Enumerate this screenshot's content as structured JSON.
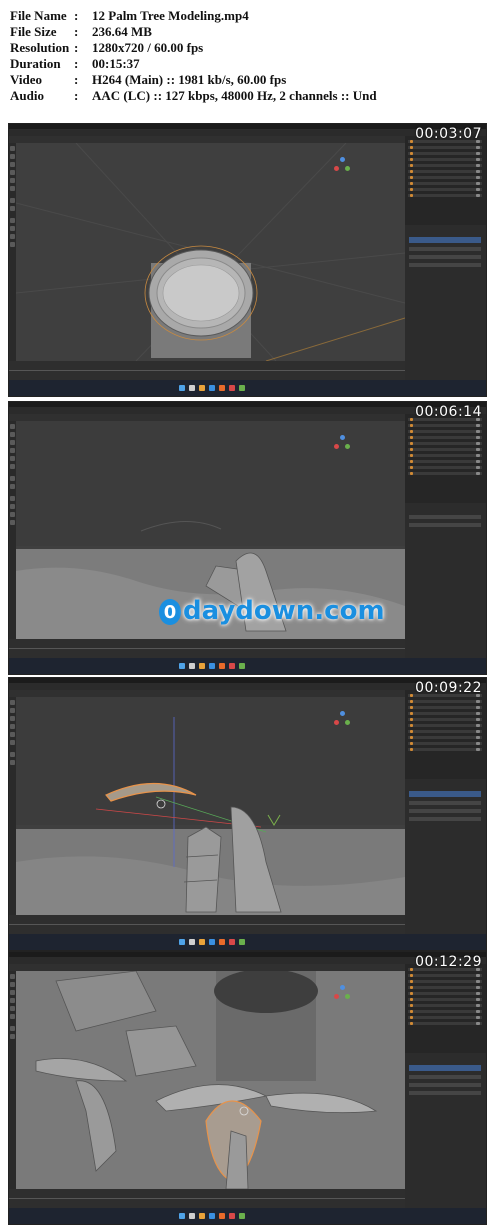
{
  "info": {
    "rows": [
      {
        "key": "File Name",
        "value": "12 Palm Tree Modeling.mp4"
      },
      {
        "key": "File Size",
        "value": "236.64 MB"
      },
      {
        "key": "Resolution",
        "value": "1280x720 / 60.00 fps"
      },
      {
        "key": "Duration",
        "value": "00:15:37"
      },
      {
        "key": "Video",
        "value": "H264 (Main) :: 1981 kb/s, 60.00 fps"
      },
      {
        "key": "Audio",
        "value": "AAC (LC) :: 127 kbps, 48000 Hz, 2 channels :: Und"
      }
    ],
    "separator": ":"
  },
  "frames": [
    {
      "timestamp": "00:03:07"
    },
    {
      "timestamp": "00:06:14"
    },
    {
      "timestamp": "00:09:22"
    },
    {
      "timestamp": "00:12:29"
    }
  ],
  "watermark": {
    "text": "daydown.com",
    "icon": "water-drop-logo"
  },
  "colors": {
    "viewport": "#3f3f3f",
    "panel": "#2c2c2c",
    "taskbar": "#1e2430",
    "selection_outline": "#e8934a",
    "watermark": "#1a8fe0"
  }
}
